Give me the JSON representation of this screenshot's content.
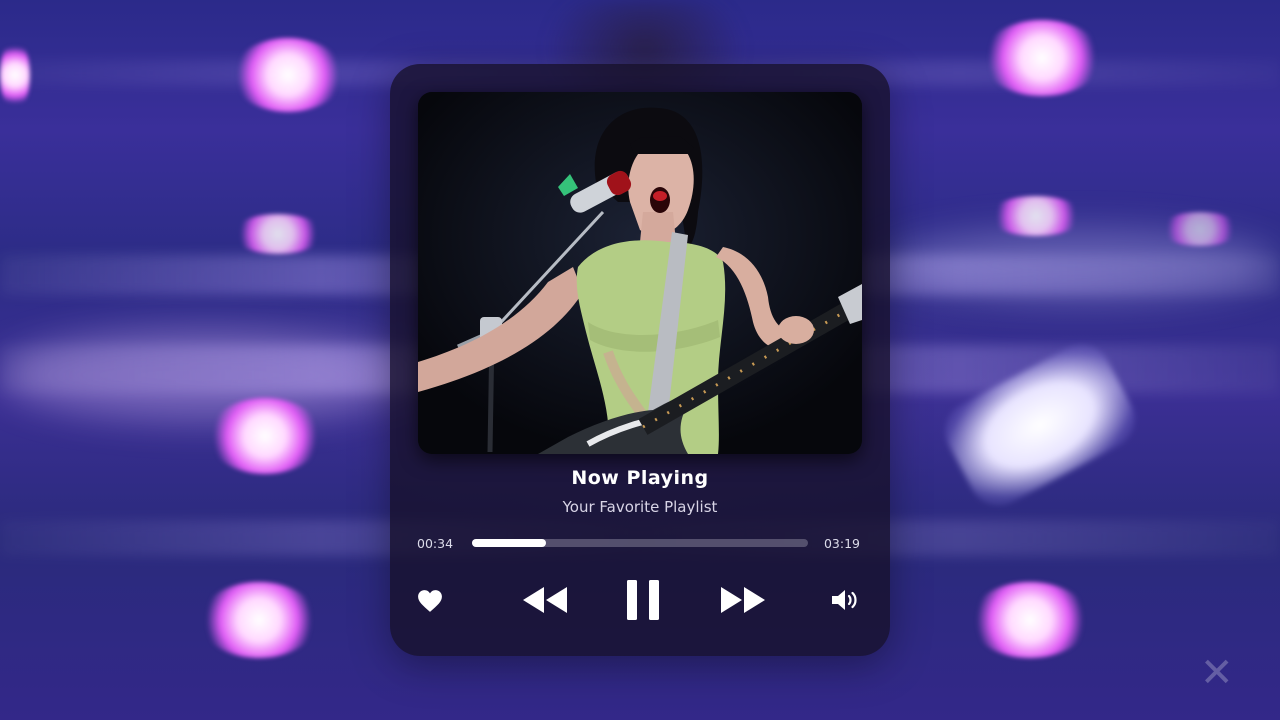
{
  "player": {
    "title": "Now  Playing",
    "subtitle": "Your Favorite Playlist",
    "elapsed": "00:34",
    "duration": "03:19",
    "progress": 0.22
  },
  "controls": {
    "like_icon": "heart-icon",
    "rewind_icon": "rewind-icon",
    "pause_icon": "pause-icon",
    "forward_icon": "fast-forward-icon",
    "volume_icon": "volume-icon"
  },
  "colors": {
    "accent": "#ffffff",
    "card": "#161028",
    "track": "#827d96",
    "stage_glow": "#e05cf5"
  }
}
